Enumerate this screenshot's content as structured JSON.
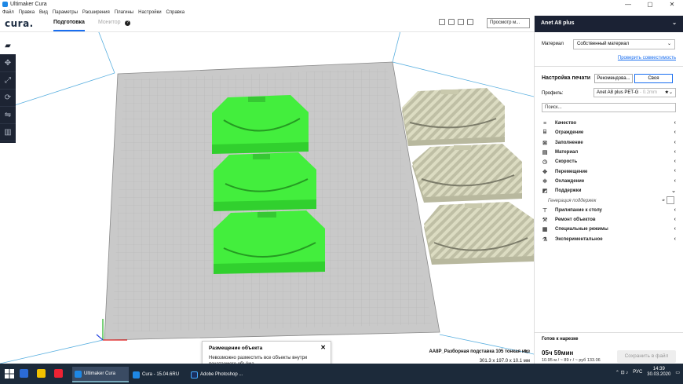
{
  "window": {
    "title": "Ultimaker Cura",
    "controls": [
      "—",
      "▢",
      "✕"
    ]
  },
  "menu": [
    "Файл",
    "Правка",
    "Вид",
    "Параметры",
    "Расширения",
    "Плагины",
    "Настройки",
    "Справка"
  ],
  "header": {
    "logo": "cura.",
    "tab_prepare": "Подготовка",
    "tab_monitor": "Монитор",
    "help": "?",
    "view_select": "Просмотр м..."
  },
  "colors": {
    "accent": "#196ef0",
    "toolbar_bg": "#1d2433",
    "selected_model": "#43ee3d",
    "other_model": "#d6d6b4",
    "build_plate": "#c7c7c7"
  },
  "toolbar": {
    "icons": [
      "open-folder-icon",
      "move-icon",
      "scale-icon",
      "rotate-icon",
      "mirror-icon",
      "support-blocker-icon"
    ]
  },
  "panel": {
    "printer": "Anet A8 plus",
    "material_label": "Материал",
    "material_value": "Собственный материал",
    "compat_link": "Проверить совместимость",
    "print_settings": "Настройка печати",
    "tab_recommended": "Рекомендова...",
    "tab_custom": "Своя",
    "profile_label": "Профиль:",
    "profile_value": "Anet A8 plus PET-G",
    "profile_sub": "- 0.2mm",
    "search_placeholder": "Поиск...",
    "categories": [
      {
        "icon": "≡",
        "label": "Качество",
        "open": false
      },
      {
        "icon": "⌸",
        "label": "Ограждение",
        "open": false
      },
      {
        "icon": "⊠",
        "label": "Заполнение",
        "open": false
      },
      {
        "icon": "▤",
        "label": "Материал",
        "open": false
      },
      {
        "icon": "◷",
        "label": "Скорость",
        "open": false
      },
      {
        "icon": "✥",
        "label": "Перемещение",
        "open": false
      },
      {
        "icon": "✲",
        "label": "Охлаждение",
        "open": false
      },
      {
        "icon": "◩",
        "label": "Поддержки",
        "open": true
      }
    ],
    "support_generation": "Генерация поддержек",
    "categories2": [
      {
        "icon": "⊤",
        "label": "Прилипание к столу"
      },
      {
        "icon": "⚒",
        "label": "Ремонт объектов"
      },
      {
        "icon": "▦",
        "label": "Специальные режимы"
      },
      {
        "icon": "⚗",
        "label": "Экспериментальное"
      }
    ],
    "ready_title": "Готов к нарезке",
    "time": "05ч 59мин",
    "cost": "10.95 м / ~ 89 г / ~ руб 133.06",
    "save_button": "Сохранить в файл"
  },
  "toast": {
    "title": "Размещение объекта",
    "body": "Невозможно разместить все объекты внутри печатаемого объёма",
    "close": "✕"
  },
  "object": {
    "name": "AA8P_Разборная подставка 105 тонкая низ",
    "dims": "301.3 x 197.0 x 10.1 мм"
  },
  "taskbar": {
    "apps": [
      {
        "label": "Ultimaker Cura",
        "color": "#1e88e5",
        "active": true
      },
      {
        "label": "Cura - 15.04.6RU",
        "color": "#1e88e5",
        "active": false
      },
      {
        "label": "Adobe Photoshop ...",
        "color": "#1b2f5e",
        "active": false
      }
    ],
    "lang": "РУС",
    "time": "14:39",
    "date": "30.03.2020"
  }
}
